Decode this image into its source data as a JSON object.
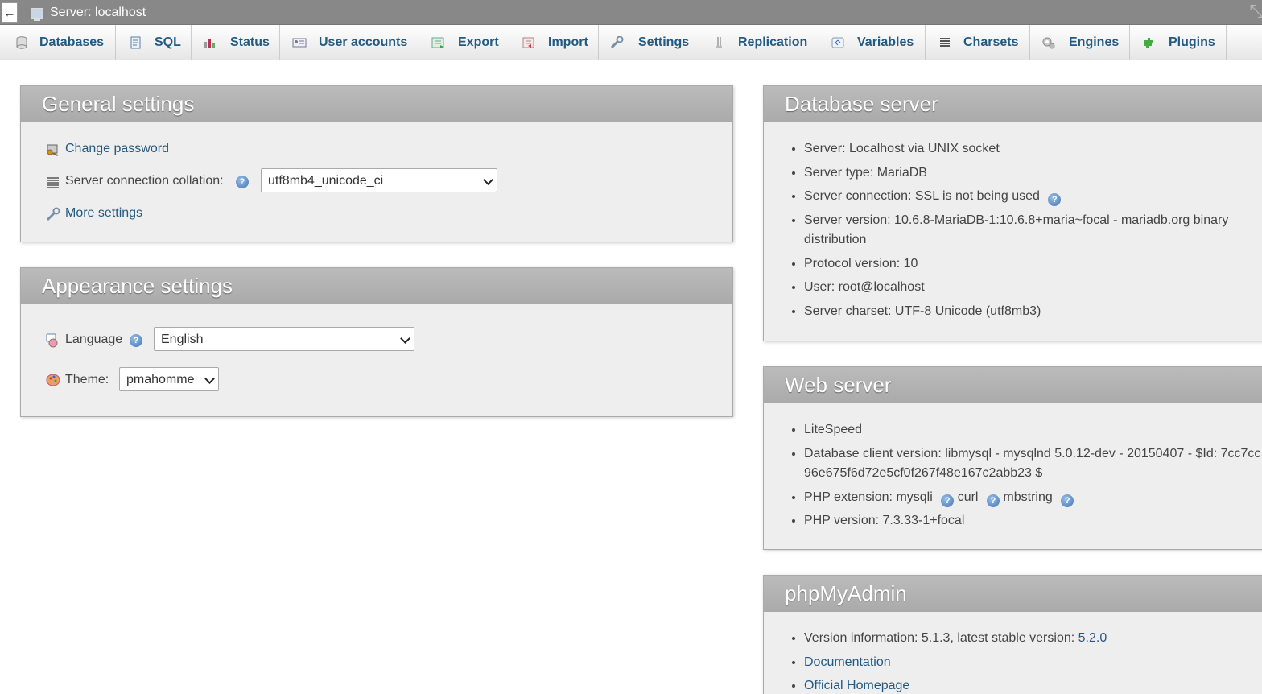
{
  "topbar": {
    "back_label": "←",
    "title": "Server: localhost",
    "corner_glyph": "⤡"
  },
  "tabs": [
    {
      "label": "Databases",
      "icon": "database-icon"
    },
    {
      "label": "SQL",
      "icon": "sql-icon"
    },
    {
      "label": "Status",
      "icon": "status-icon"
    },
    {
      "label": "User accounts",
      "icon": "users-icon"
    },
    {
      "label": "Export",
      "icon": "export-icon"
    },
    {
      "label": "Import",
      "icon": "import-icon"
    },
    {
      "label": "Settings",
      "icon": "wrench-icon"
    },
    {
      "label": "Replication",
      "icon": "replication-icon"
    },
    {
      "label": "Variables",
      "icon": "variables-icon"
    },
    {
      "label": "Charsets",
      "icon": "charsets-icon"
    },
    {
      "label": "Engines",
      "icon": "engines-icon"
    },
    {
      "label": "Plugins",
      "icon": "plugin-icon"
    }
  ],
  "general": {
    "title": "General settings",
    "change_password": "Change password",
    "collation_label": "Server connection collation:",
    "collation_value": "utf8mb4_unicode_ci",
    "more_settings": "More settings"
  },
  "appearance": {
    "title": "Appearance settings",
    "language_label": "Language",
    "language_value": "English",
    "theme_label": "Theme:",
    "theme_value": "pmahomme"
  },
  "db_server": {
    "title": "Database server",
    "items": [
      "Server: Localhost via UNIX socket",
      "Server type: MariaDB",
      "Server connection: SSL is not being used",
      "Server version: 10.6.8-MariaDB-1:10.6.8+maria~focal - mariadb.org binary distribution",
      "Protocol version: 10",
      "User: root@localhost",
      "Server charset: UTF-8 Unicode (utf8mb3)"
    ]
  },
  "web_server": {
    "title": "Web server",
    "items": [
      "LiteSpeed",
      "Database client version: libmysql - mysqlnd 5.0.12-dev - 20150407 - $Id: 7cc7cc96e675f6d72e5cf0f267f48e167c2abb23 $",
      "PHP extension:",
      "PHP version: 7.3.33-1+focal"
    ],
    "php_ext": [
      "mysqli",
      "curl",
      "mbstring"
    ]
  },
  "phpmyadmin": {
    "title": "phpMyAdmin",
    "version_text": "Version information: 5.1.3, latest stable version: ",
    "latest_version": "5.2.0",
    "links": [
      "Documentation",
      "Official Homepage"
    ]
  },
  "help_glyph": "?",
  "colors": {
    "link": "#235a81",
    "panel_header": "#aaaaaa",
    "panel_bg": "#eeeeee",
    "topbar": "#888888"
  }
}
